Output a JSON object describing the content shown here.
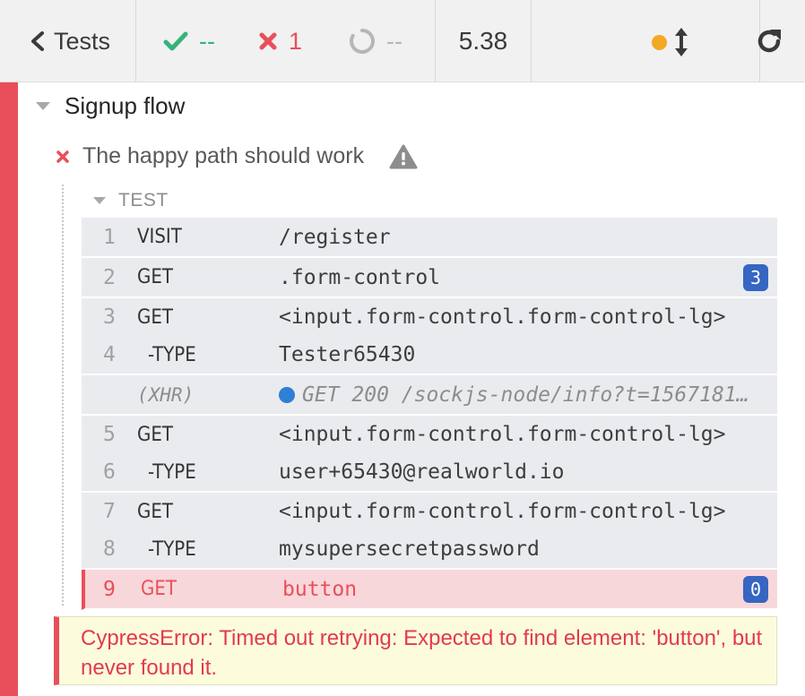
{
  "header": {
    "back_label": "Tests",
    "passed": "--",
    "failed": "1",
    "pending": "--",
    "duration": "5.38"
  },
  "colors": {
    "passed": "#34b37a",
    "failed": "#e94f5a",
    "pending": "#b6b6b6",
    "running_dot": "#f2a924",
    "badge": "#3665c2",
    "xhr_dot": "#2f7fd4"
  },
  "icons": {
    "back": "chevron-left-icon",
    "passed": "check-icon",
    "failed": "x-icon",
    "pending": "circle-notch-icon",
    "resize": "arrows-vertical-icon",
    "reload": "redo-icon",
    "warning": "warning-icon"
  },
  "suite": {
    "title": "Signup flow"
  },
  "test": {
    "title": "The happy path should work",
    "hook_label": "TEST"
  },
  "commands": [
    {
      "num": "1",
      "name": "VISIT",
      "message": "/register"
    },
    {
      "num": "2",
      "name": "GET",
      "message": ".form-control",
      "badge": "3"
    },
    {
      "num": "3",
      "name": "GET",
      "message": "<input.form-control.form-control-lg>"
    },
    {
      "num": "4",
      "name": "-TYPE",
      "message": "Tester65430"
    },
    {
      "num": "",
      "name": "(XHR)",
      "message": "GET 200 /sockjs-node/info?t=1567181…"
    },
    {
      "num": "5",
      "name": "GET",
      "message": "<input.form-control.form-control-lg>"
    },
    {
      "num": "6",
      "name": "-TYPE",
      "message": "user+65430@realworld.io"
    },
    {
      "num": "7",
      "name": "GET",
      "message": "<input.form-control.form-control-lg>"
    },
    {
      "num": "8",
      "name": "-TYPE",
      "message": "mysupersecretpassword"
    },
    {
      "num": "9",
      "name": "GET",
      "message": "button",
      "badge": "0"
    }
  ],
  "error": {
    "message": "CypressError: Timed out retrying: Expected to find element: 'button', but never found it."
  }
}
